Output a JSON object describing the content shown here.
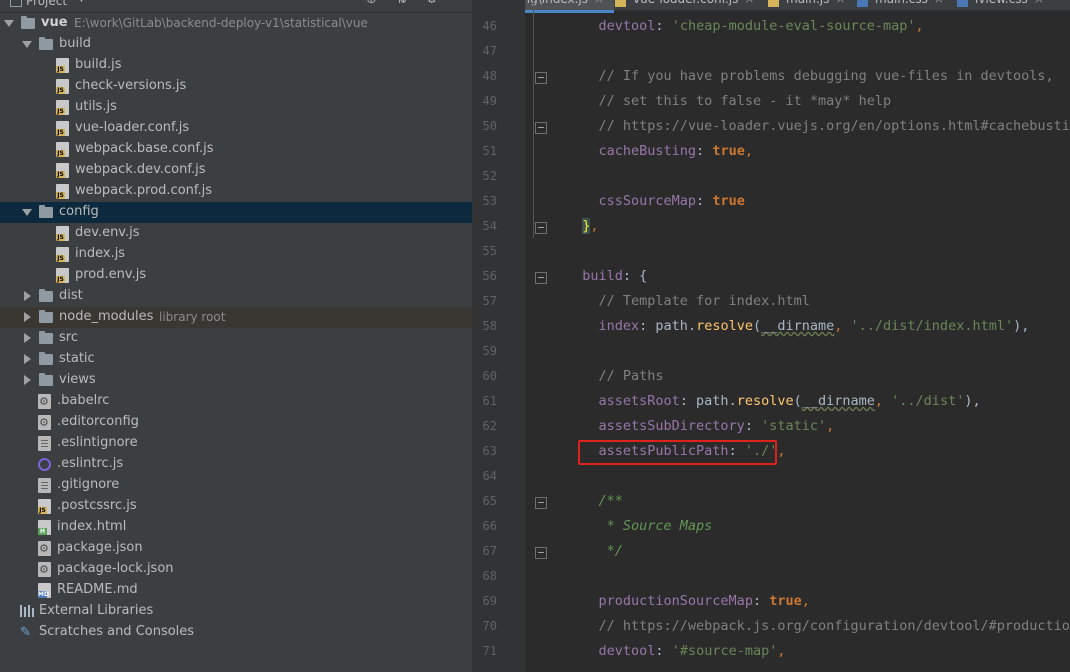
{
  "project_panel": {
    "title": "Project",
    "tree": [
      {
        "label": "vue",
        "sub": "E:\\work\\GitLab\\backend-deploy-v1\\statistical\\vue",
        "kind": "folder",
        "depth": 0,
        "expanded": true,
        "bold": true
      },
      {
        "label": "build",
        "kind": "folder",
        "depth": 1,
        "expanded": true
      },
      {
        "label": "build.js",
        "kind": "js",
        "depth": 2
      },
      {
        "label": "check-versions.js",
        "kind": "js",
        "depth": 2
      },
      {
        "label": "utils.js",
        "kind": "js",
        "depth": 2
      },
      {
        "label": "vue-loader.conf.js",
        "kind": "js",
        "depth": 2
      },
      {
        "label": "webpack.base.conf.js",
        "kind": "js",
        "depth": 2
      },
      {
        "label": "webpack.dev.conf.js",
        "kind": "js",
        "depth": 2
      },
      {
        "label": "webpack.prod.conf.js",
        "kind": "js",
        "depth": 2
      },
      {
        "label": "config",
        "kind": "folder",
        "depth": 1,
        "expanded": true,
        "selected": true
      },
      {
        "label": "dev.env.js",
        "kind": "js",
        "depth": 2
      },
      {
        "label": "index.js",
        "kind": "js",
        "depth": 2
      },
      {
        "label": "prod.env.js",
        "kind": "js",
        "depth": 2
      },
      {
        "label": "dist",
        "kind": "folder",
        "depth": 1,
        "expanded": false
      },
      {
        "label": "node_modules",
        "sub": "library root",
        "kind": "folder",
        "depth": 1,
        "expanded": false,
        "library": true
      },
      {
        "label": "src",
        "kind": "folder",
        "depth": 1,
        "expanded": false
      },
      {
        "label": "static",
        "kind": "folder",
        "depth": 1,
        "expanded": false
      },
      {
        "label": "views",
        "kind": "folder",
        "depth": 1,
        "expanded": false
      },
      {
        "label": ".babelrc",
        "kind": "gear",
        "depth": 1
      },
      {
        "label": ".editorconfig",
        "kind": "gear",
        "depth": 1
      },
      {
        "label": ".eslintignore",
        "kind": "plain",
        "depth": 1
      },
      {
        "label": ".eslintrc.js",
        "kind": "ring",
        "depth": 1
      },
      {
        "label": ".gitignore",
        "kind": "plain",
        "depth": 1
      },
      {
        "label": ".postcssrc.js",
        "kind": "js",
        "depth": 1
      },
      {
        "label": "index.html",
        "kind": "html",
        "depth": 1
      },
      {
        "label": "package.json",
        "kind": "gear",
        "depth": 1
      },
      {
        "label": "package-lock.json",
        "kind": "gear",
        "depth": 1
      },
      {
        "label": "README.md",
        "kind": "md",
        "depth": 1
      },
      {
        "label": "External Libraries",
        "kind": "libs",
        "depth": 0
      },
      {
        "label": "Scratches and Consoles",
        "kind": "scratch",
        "depth": 0
      }
    ]
  },
  "editor": {
    "tabs": [
      {
        "label": "config\\index.js",
        "icon": "js",
        "active": true
      },
      {
        "label": "vue-loader.conf.js",
        "icon": "js"
      },
      {
        "label": "main.js",
        "icon": "js"
      },
      {
        "label": "main.css",
        "icon": "css"
      },
      {
        "label": "iview.css",
        "icon": "css"
      }
    ],
    "highlighted_line": 63,
    "lines": [
      {
        "n": "46",
        "tokens": [
          [
            "",
            "    "
          ],
          [
            "prop",
            "devtool"
          ],
          [
            "",
            ": "
          ],
          [
            "str",
            "'cheap-module-eval-source-map'"
          ],
          [
            "pun",
            ","
          ]
        ]
      },
      {
        "n": "47",
        "tokens": []
      },
      {
        "n": "48",
        "tokens": [
          [
            "",
            "    "
          ],
          [
            "com",
            "// If you have problems debugging vue-files in devtools,"
          ]
        ]
      },
      {
        "n": "49",
        "tokens": [
          [
            "",
            "    "
          ],
          [
            "com",
            "// set this to false - it *may* help"
          ]
        ]
      },
      {
        "n": "50",
        "tokens": [
          [
            "",
            "    "
          ],
          [
            "com",
            "// https://vue-loader.vuejs.org/en/options.html#cachebusting"
          ]
        ]
      },
      {
        "n": "51",
        "tokens": [
          [
            "",
            "    "
          ],
          [
            "prop",
            "cacheBusting"
          ],
          [
            "",
            ": "
          ],
          [
            "kw",
            "true"
          ],
          [
            "pun",
            ","
          ]
        ]
      },
      {
        "n": "52",
        "tokens": []
      },
      {
        "n": "53",
        "tokens": [
          [
            "",
            "    "
          ],
          [
            "prop",
            "cssSourceMap"
          ],
          [
            "",
            ": "
          ],
          [
            "kw",
            "true"
          ]
        ]
      },
      {
        "n": "54",
        "tokens": [
          [
            "",
            "  "
          ],
          [
            "bracehl",
            "}"
          ],
          [
            "pun",
            ","
          ]
        ]
      },
      {
        "n": "55",
        "tokens": []
      },
      {
        "n": "56",
        "tokens": [
          [
            "",
            "  "
          ],
          [
            "prop",
            "build"
          ],
          [
            "",
            ": {"
          ]
        ]
      },
      {
        "n": "57",
        "tokens": [
          [
            "",
            "    "
          ],
          [
            "com",
            "// Template for index.html"
          ]
        ]
      },
      {
        "n": "58",
        "tokens": [
          [
            "",
            "    "
          ],
          [
            "prop",
            "index"
          ],
          [
            "",
            ": path."
          ],
          [
            "fn",
            "resolve"
          ],
          [
            "",
            "("
          ],
          [
            "u",
            "__dirname"
          ],
          [
            "pun",
            ", "
          ],
          [
            "str",
            "'../dist/index.html'"
          ],
          [
            "",
            "),"
          ]
        ]
      },
      {
        "n": "59",
        "tokens": []
      },
      {
        "n": "60",
        "tokens": [
          [
            "",
            "    "
          ],
          [
            "com",
            "// Paths"
          ]
        ]
      },
      {
        "n": "61",
        "tokens": [
          [
            "",
            "    "
          ],
          [
            "prop",
            "assetsRoot"
          ],
          [
            "",
            ": path."
          ],
          [
            "fn",
            "resolve"
          ],
          [
            "",
            "("
          ],
          [
            "u",
            "__dirname"
          ],
          [
            "pun",
            ", "
          ],
          [
            "str",
            "'../dist'"
          ],
          [
            "",
            "),"
          ]
        ]
      },
      {
        "n": "62",
        "tokens": [
          [
            "",
            "    "
          ],
          [
            "prop",
            "assetsSubDirectory"
          ],
          [
            "",
            ": "
          ],
          [
            "str",
            "'static'"
          ],
          [
            "pun",
            ","
          ]
        ]
      },
      {
        "n": "63",
        "tokens": [
          [
            "",
            "    "
          ],
          [
            "prop",
            "assetsPublicPath"
          ],
          [
            "",
            ": "
          ],
          [
            "str",
            "'./'"
          ],
          [
            "pun",
            ","
          ]
        ]
      },
      {
        "n": "64",
        "tokens": []
      },
      {
        "n": "65",
        "tokens": [
          [
            "",
            "    "
          ],
          [
            "doc",
            "/**"
          ]
        ]
      },
      {
        "n": "66",
        "tokens": [
          [
            "",
            "     "
          ],
          [
            "doc",
            "* Source Maps"
          ]
        ]
      },
      {
        "n": "67",
        "tokens": [
          [
            "",
            "     "
          ],
          [
            "doc",
            "*/"
          ]
        ]
      },
      {
        "n": "68",
        "tokens": []
      },
      {
        "n": "69",
        "tokens": [
          [
            "",
            "    "
          ],
          [
            "prop",
            "productionSourceMap"
          ],
          [
            "",
            ": "
          ],
          [
            "kw",
            "true"
          ],
          [
            "pun",
            ","
          ]
        ]
      },
      {
        "n": "70",
        "tokens": [
          [
            "",
            "    "
          ],
          [
            "com",
            "// https://webpack.js.org/configuration/devtool/#production"
          ]
        ]
      },
      {
        "n": "71",
        "tokens": [
          [
            "",
            "    "
          ],
          [
            "prop",
            "devtool"
          ],
          [
            "",
            ": "
          ],
          [
            "str",
            "'#source-map'"
          ],
          [
            "pun",
            ","
          ]
        ]
      }
    ]
  },
  "colors": {
    "panel_bg": "#3c3f41",
    "editor_bg": "#2b2b2b",
    "selection": "#0d293e",
    "property": "#9876aa",
    "string": "#6a8759",
    "keyword": "#cc7832",
    "comment": "#808080",
    "highlight_box": "#e0221c"
  }
}
